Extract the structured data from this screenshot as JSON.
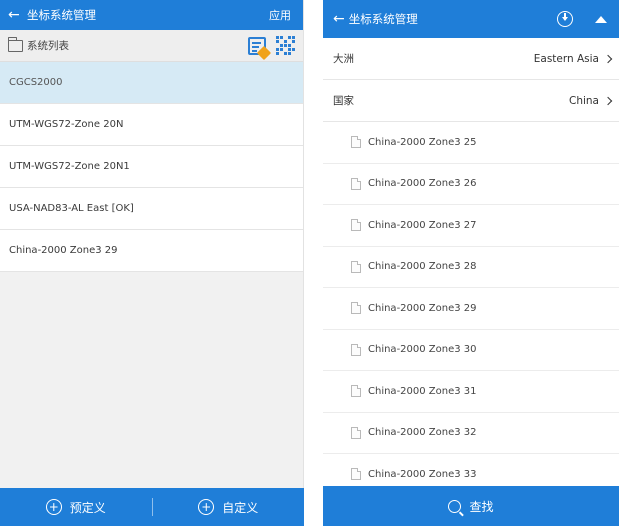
{
  "left": {
    "header": {
      "title": "坐标系统管理",
      "action": "应用"
    },
    "list_label": "系统列表",
    "systems": [
      "CGCS2000",
      "UTM-WGS72-Zone 20N",
      "UTM-WGS72-Zone 20N1",
      "USA-NAD83-AL East [OK]",
      "China-2000 Zone3 29"
    ],
    "footer": {
      "predefined": "预定义",
      "custom": "自定义"
    }
  },
  "right": {
    "header": {
      "title": "坐标系统管理"
    },
    "continent": {
      "label": "大洲",
      "value": "Eastern Asia"
    },
    "country": {
      "label": "国家",
      "value": "China"
    },
    "items": [
      "China-2000 Zone3 25",
      "China-2000 Zone3 26",
      "China-2000 Zone3 27",
      "China-2000 Zone3 28",
      "China-2000 Zone3 29",
      "China-2000 Zone3 30",
      "China-2000 Zone3 31",
      "China-2000 Zone3 32",
      "China-2000 Zone3 33"
    ],
    "footer": {
      "search": "查找"
    }
  },
  "colors": {
    "primary": "#1f7ed8",
    "selected_row": "#d6eaf5",
    "accent": "#f0a21a"
  }
}
